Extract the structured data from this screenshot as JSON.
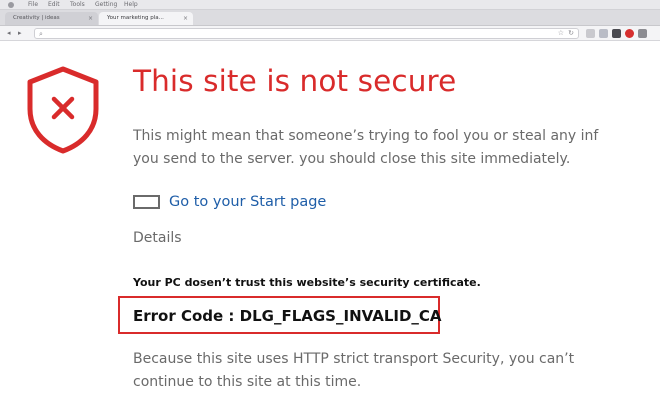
{
  "menubar": {
    "items": [
      "File",
      "Edit",
      "Tools",
      "Getting",
      "Help"
    ]
  },
  "tabs": [
    {
      "label": "Creativity | ideas",
      "active": false
    },
    {
      "label": "Your marketing pla...",
      "active": true
    }
  ],
  "tab_close_glyph": "×",
  "toolbar": {
    "back_glyph": "◂",
    "forward_glyph": "▸",
    "url": ""
  },
  "colors": {
    "accent_red": "#d92b2b",
    "link_blue": "#1f5ea8",
    "body_gray": "#6a6a6a"
  },
  "warning": {
    "icon": "shield-x-icon",
    "headline": "This site is not secure",
    "description_lines": [
      "This might mean that someone’s trying to fool you or steal any inf",
      "you send to the server. you should close this site immediately."
    ],
    "start_page_link": "Go to your Start page",
    "details_label": "Details",
    "trust_message": "Your PC dosen’t trust this website’s security certificate.",
    "error_code": "Error Code : DLG_FLAGS_INVALID_CA",
    "hsts_lines": [
      "Because this site uses HTTP strict transport Security, you can’t",
      "continue to this site at this time."
    ]
  }
}
